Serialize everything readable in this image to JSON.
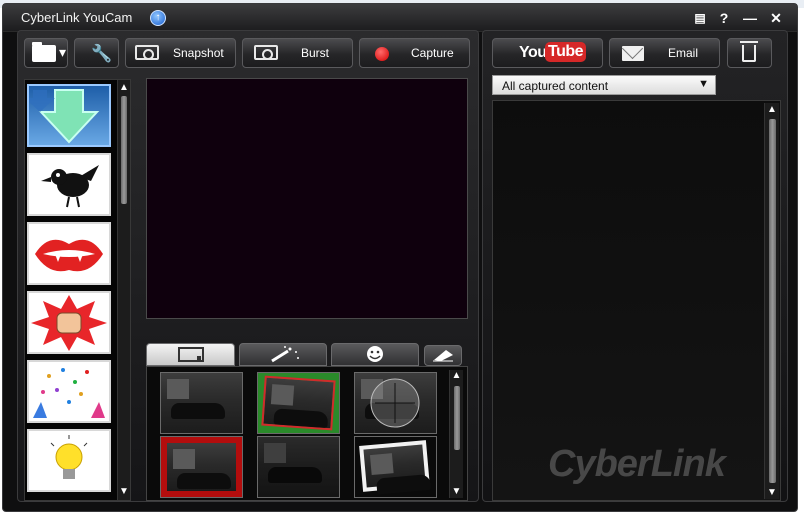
{
  "window": {
    "title": "CyberLink YouCam"
  },
  "titlebar": {
    "help": "?",
    "minimize": "—",
    "close": "✕"
  },
  "toolbar": {
    "snapshot": "Snapshot",
    "burst": "Burst",
    "capture": "Capture",
    "youtube_you": "You",
    "youtube_tube": "Tube",
    "email": "Email"
  },
  "effects": [
    "download-more",
    "bird",
    "lips",
    "punch",
    "confetti",
    "lightbulb"
  ],
  "fx_tabs": [
    "frames",
    "particles",
    "emotions",
    "eraser"
  ],
  "fx_thumbs": [
    "night-scene",
    "red-frame-scene",
    "lens-scene",
    "rose-frame-scene",
    "dark-scene",
    "photo-stack-scene"
  ],
  "gallery": {
    "filter": "All captured content"
  },
  "brand": {
    "watermark": "CyberLink"
  },
  "colors": {
    "record": "#d30000",
    "preview_bg": "#0f000d",
    "youtube_red": "#d62828"
  }
}
